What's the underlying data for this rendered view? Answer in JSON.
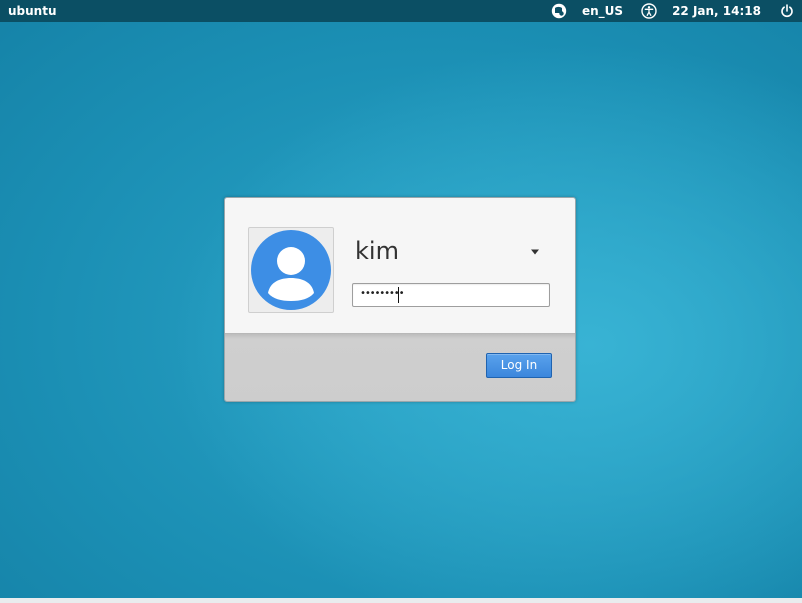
{
  "topbar": {
    "hostname": "ubuntu",
    "language": "en_US",
    "clock": "22 Jan, 14:18",
    "icons": {
      "network": "network-indicator-icon",
      "accessibility": "accessibility-icon",
      "power": "power-icon"
    }
  },
  "login": {
    "username": "kim",
    "password_mask": "•••••••••",
    "login_button_label": "Log In",
    "avatar_icon": "user-avatar-icon",
    "dropdown_icon": "chevron-down-icon"
  },
  "colors": {
    "topbar_bg": "#0b4f64",
    "desktop_bg": "#1a8db3",
    "button_blue": "#3b86dc",
    "avatar_blue": "#3d8ee5"
  }
}
